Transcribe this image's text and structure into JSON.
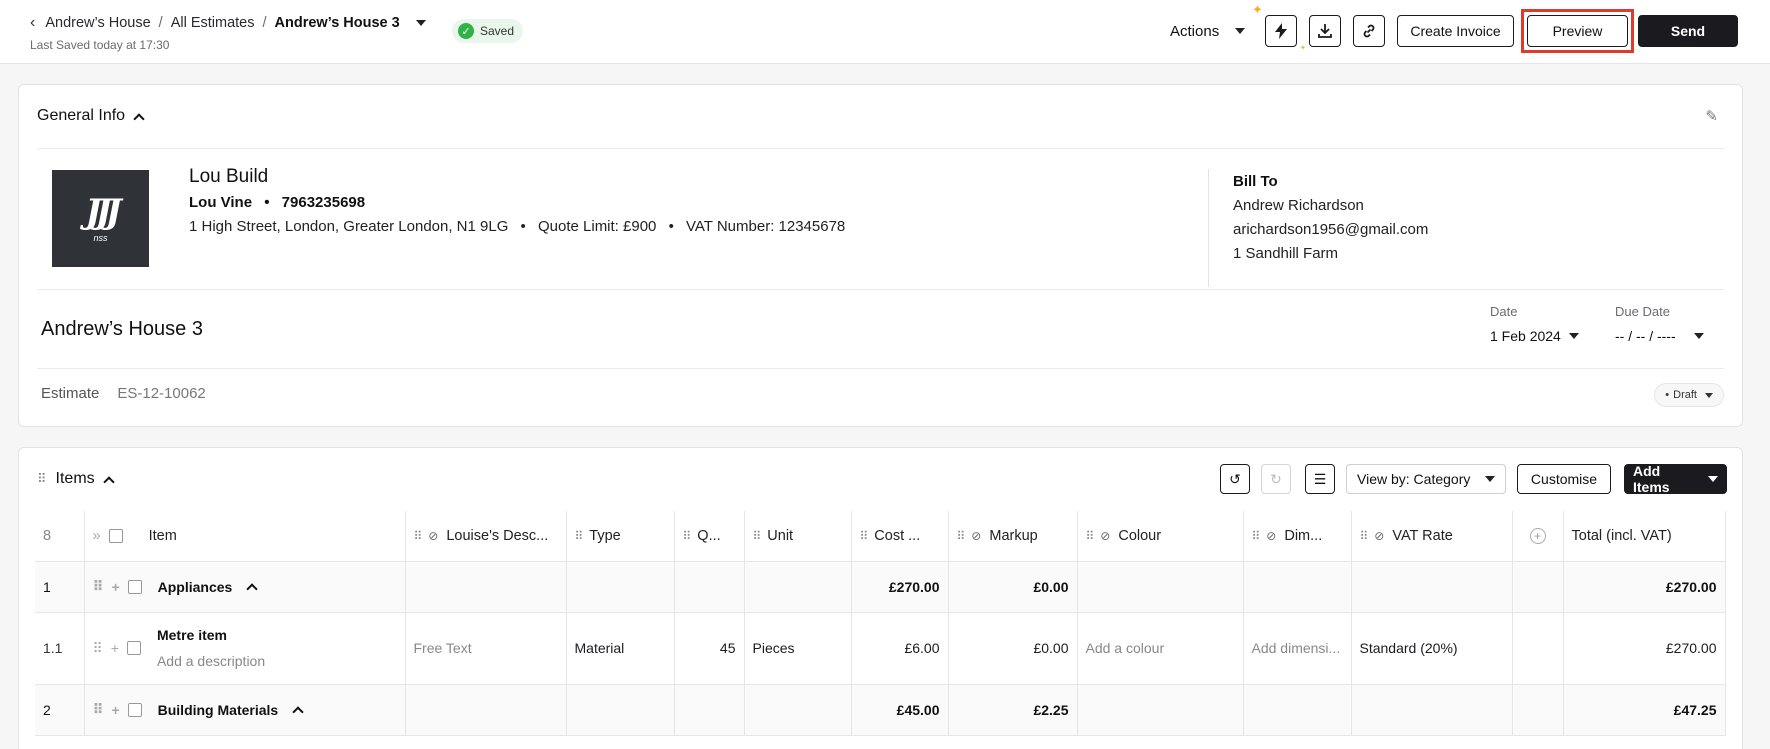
{
  "header": {
    "breadcrumb": [
      "Andrew’s House",
      "All Estimates",
      "Andrew’s House 3"
    ],
    "breadcrumb_sep": "/",
    "last_saved": "Last Saved today at 17:30",
    "saved_status": "Saved",
    "actions_label": "Actions",
    "icons": [
      "lightning-icon",
      "download-icon",
      "link-icon"
    ],
    "create_invoice": "Create Invoice",
    "preview": "Preview",
    "send": "Send"
  },
  "general_info": {
    "title": "General Info",
    "logo_text": "nss",
    "company_name": "Lou Build",
    "contact_name": "Lou Vine",
    "contact_phone": "7963235698",
    "address": "1 High Street, London, Greater London, N1 9LG",
    "quote_limit": "Quote Limit: £900",
    "vat_number": "VAT Number: 12345678",
    "bullet": "•",
    "bill_to": {
      "label": "Bill To",
      "name": "Andrew Richardson",
      "email": "arichardson1956@gmail.com",
      "address": "1 Sandhill Farm"
    },
    "estimate_title": "Andrew’s House 3",
    "date_label": "Date",
    "date_value": "1 Feb 2024",
    "due_label": "Due Date",
    "due_value": "-- / -- / ----",
    "estimate_label": "Estimate",
    "estimate_number": "ES-12-10062",
    "status": "Draft"
  },
  "items": {
    "title": "Items",
    "view_by": "View by: Category",
    "customise": "Customise",
    "add_items": "Add Items",
    "count": "8",
    "columns": [
      "Item",
      "Louise's Desc...",
      "Type",
      "Q...",
      "Unit",
      "Cost ...",
      "Markup",
      "Colour",
      "Dim...",
      "VAT Rate",
      "Total (incl. VAT)"
    ],
    "rows": [
      {
        "kind": "category",
        "num": "1",
        "name": "Appliances",
        "cost": "£270.00",
        "markup": "£0.00",
        "total": "£270.00"
      },
      {
        "kind": "line",
        "num": "1.1",
        "name": "Metre item",
        "desc": "Add a description",
        "free": "Free Text",
        "type": "Material",
        "qty": "45",
        "unit": "Pieces",
        "cost": "£6.00",
        "markup": "£0.00",
        "colour": "Add a colour",
        "dim": "Add dimensi...",
        "vat": "Standard (20%)",
        "total": "£270.00"
      },
      {
        "kind": "category",
        "num": "2",
        "name": "Building Materials",
        "cost": "£45.00",
        "markup": "£2.25",
        "total": "£47.25"
      }
    ]
  },
  "colors": {
    "accent": "#1b1b1f",
    "saved_green": "#2fb344",
    "highlight_red": "#e03a2f"
  }
}
